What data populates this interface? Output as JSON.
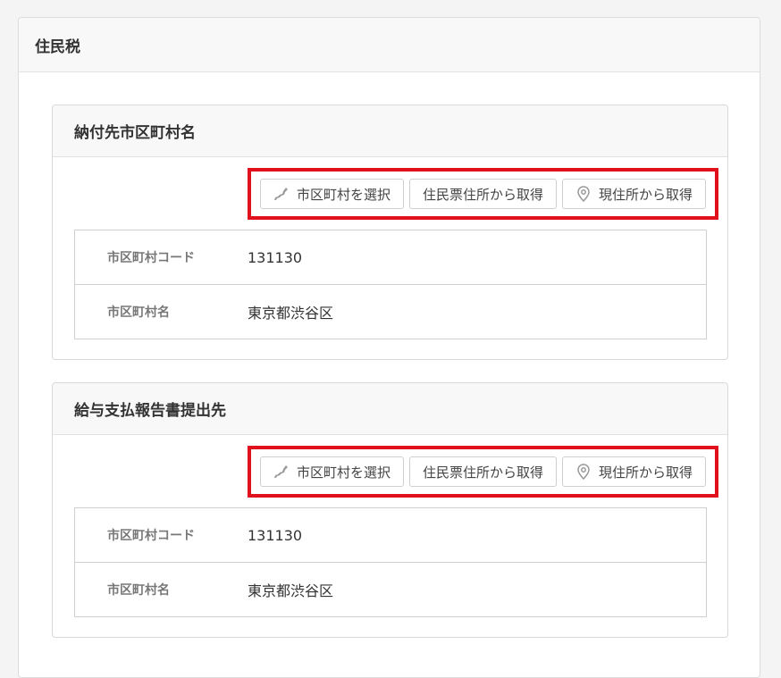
{
  "section": {
    "title": "住民税"
  },
  "panels": [
    {
      "title": "納付先市区町村名",
      "buttons": {
        "select_label": "市区町村を選択",
        "resident_label": "住民票住所から取得",
        "current_label": "現住所から取得"
      },
      "rows": [
        {
          "label": "市区町村コード",
          "value": "131130"
        },
        {
          "label": "市区町村名",
          "value": "東京都渋谷区"
        }
      ]
    },
    {
      "title": "給与支払報告書提出先",
      "buttons": {
        "select_label": "市区町村を選択",
        "resident_label": "住民票住所から取得",
        "current_label": "現住所から取得"
      },
      "rows": [
        {
          "label": "市区町村コード",
          "value": "131130"
        },
        {
          "label": "市区町村名",
          "value": "東京都渋谷区"
        }
      ]
    }
  ],
  "icons": {
    "select": "japan-map-icon",
    "current": "location-pin-icon"
  },
  "colors": {
    "highlight": "#e0101c"
  }
}
